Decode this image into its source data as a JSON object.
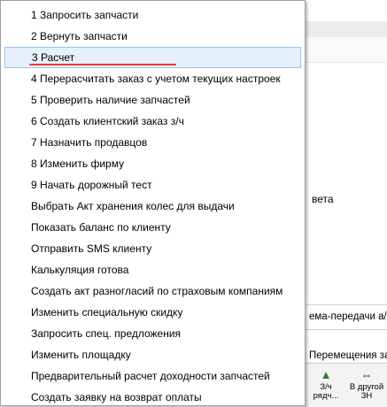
{
  "background": {
    "fragments": {
      "veta": "вета",
      "scheme": "ема-передачи а/м",
      "moves": "Перемещения зап"
    },
    "toolbar": {
      "buttons": [
        {
          "label": "З/ч\nрядч...",
          "icon": "tree-icon"
        },
        {
          "label": "В другой\nЗН",
          "icon": "transfer-arrows-icon"
        }
      ]
    }
  },
  "menu": {
    "selected_index": 2,
    "items": [
      {
        "label": "1 Запросить запчасти"
      },
      {
        "label": "2 Вернуть запчасти"
      },
      {
        "label": "3 Расчет"
      },
      {
        "label": "4 Перерасчитать заказ с учетом текущих настроек"
      },
      {
        "label": "5 Проверить наличие запчастей"
      },
      {
        "label": "6 Создать клиентский заказ з/ч"
      },
      {
        "label": "7 Назначить продавцов"
      },
      {
        "label": "8 Изменить фирму"
      },
      {
        "label": "9 Начать дорожный тест"
      },
      {
        "label": "Выбрать Акт хранения колес для выдачи"
      },
      {
        "label": "Показать баланс по клиенту"
      },
      {
        "label": "Отправить SMS клиенту"
      },
      {
        "label": "Калькуляция готова"
      },
      {
        "label": "Создать акт разногласий по страховым компаниям"
      },
      {
        "label": "Изменить специальную скидку"
      },
      {
        "label": "Запросить спец. предложения"
      },
      {
        "label": "Изменить площадку"
      },
      {
        "label": "Предварительный расчет доходности запчастей"
      },
      {
        "label": "Создать заявку на возврат оплаты"
      }
    ]
  },
  "colors": {
    "selection_fill": "#e5f0fb",
    "selection_border": "#99c2ef",
    "annotation_underline": "#e23a3a"
  }
}
